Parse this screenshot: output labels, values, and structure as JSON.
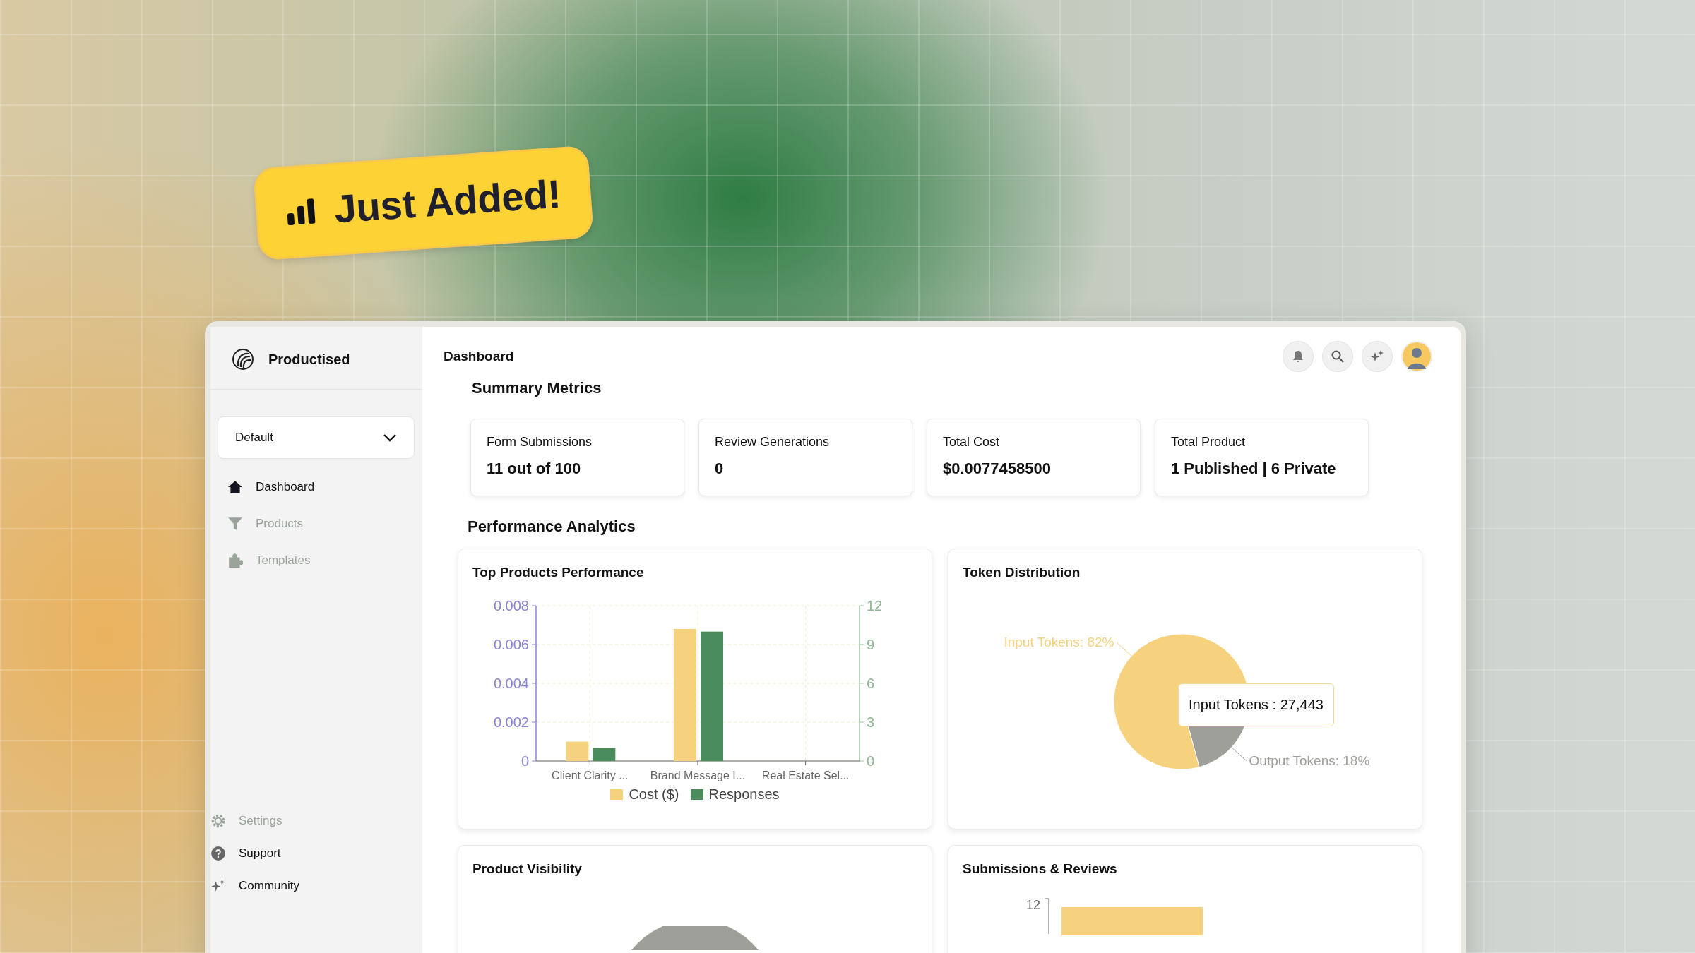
{
  "badge": {
    "label": "Just Added!"
  },
  "sidebar": {
    "brand": "Productised",
    "workspace": {
      "value": "Default"
    },
    "items": [
      {
        "label": "Dashboard",
        "disabled": false
      },
      {
        "label": "Products",
        "disabled": true
      },
      {
        "label": "Templates",
        "disabled": true
      }
    ],
    "footer_items": [
      {
        "label": "Settings",
        "disabled": true
      },
      {
        "label": "Support",
        "disabled": false
      },
      {
        "label": "Community",
        "disabled": false
      }
    ]
  },
  "header": {
    "title": "Dashboard"
  },
  "summary": {
    "title": "Summary Metrics",
    "cards": [
      {
        "label": "Form Submissions",
        "value": "11 out of 100"
      },
      {
        "label": "Review Generations",
        "value": "0"
      },
      {
        "label": "Total Cost",
        "value": "$0.0077458500"
      },
      {
        "label": "Total Product",
        "value": "1 Published | 6 Private"
      }
    ]
  },
  "analytics": {
    "title": "Performance Analytics",
    "top_products": {
      "title": "Top Products Performance",
      "chart_data": {
        "type": "bar",
        "grid": true,
        "categories": [
          "Client Clarity ...",
          "Brand Message I...",
          "Real Estate Sel..."
        ],
        "series": [
          {
            "name": "Cost ($)",
            "color": "#f7d27e",
            "values": [
              0.001,
              0.0068,
              0
            ]
          },
          {
            "name": "Responses",
            "color": "#4a8c5c",
            "axis": "y2",
            "values": [
              1,
              10,
              0
            ]
          }
        ],
        "ylim": [
          0,
          0.008
        ],
        "yticks": [
          {
            "value": 0,
            "label": "0"
          },
          {
            "value": 0.002,
            "label": "0.002"
          },
          {
            "value": 0.004,
            "label": "0.004"
          },
          {
            "value": 0.006,
            "label": "0.006"
          },
          {
            "value": 0.008,
            "label": "0.008"
          }
        ],
        "y2lim": [
          0,
          12
        ],
        "y2ticks": [
          {
            "value": 0,
            "label": "0"
          },
          {
            "value": 3,
            "label": "3"
          },
          {
            "value": 6,
            "label": "6"
          },
          {
            "value": 9,
            "label": "9"
          },
          {
            "value": 12,
            "label": "12"
          }
        ]
      }
    },
    "tokens": {
      "title": "Token Distribution",
      "chart_data": {
        "type": "pie",
        "categories": [
          "Input Tokens",
          "Output Tokens"
        ],
        "values": [
          82,
          18
        ],
        "colors": [
          "#f7d27e",
          "#9e9f99"
        ],
        "value_labels": [
          "82%",
          "18%"
        ]
      },
      "tooltip": "Input Tokens : 27,443"
    },
    "visibility": {
      "title": "Product Visibility"
    },
    "submissions": {
      "title": "Submissions & Reviews",
      "ytick": "12"
    }
  }
}
